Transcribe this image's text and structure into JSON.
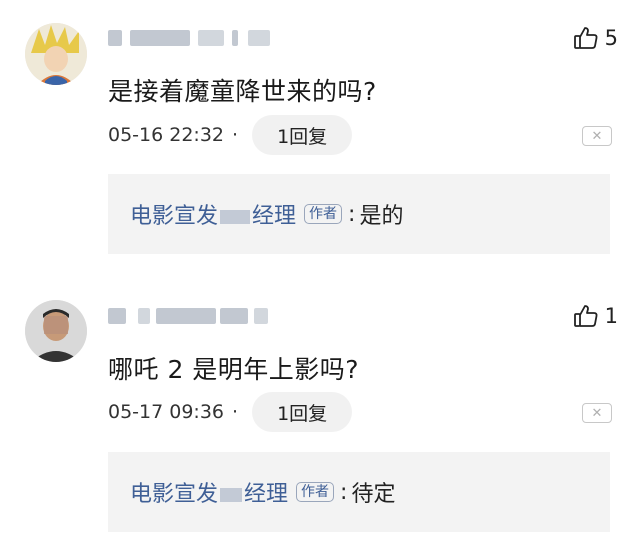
{
  "comments": [
    {
      "likes": "5",
      "text": "是接着魔童降世来的吗?",
      "time": "05-16 22:32",
      "reply_count_label": "1回复",
      "reply": {
        "author_prefix": "电影宣发",
        "author_suffix": "经理",
        "badge": "作者",
        "sep": ":",
        "text": "是的"
      }
    },
    {
      "likes": "1",
      "text": "哪吒 2 是明年上影吗?",
      "time": "05-17 09:36",
      "reply_count_label": "1回复",
      "reply": {
        "author_prefix": "电影宣发",
        "author_suffix": "经理",
        "badge": "作者",
        "sep": ":",
        "text": "待定"
      }
    }
  ],
  "icons": {
    "like": "thumbs-up-icon",
    "close": "close-icon",
    "dot": "·",
    "close_glyph": "✕"
  },
  "colors": {
    "author_link": "#3f5f96",
    "reply_bg": "#f3f3f3",
    "reply_button_bg": "#f1f1f1"
  }
}
